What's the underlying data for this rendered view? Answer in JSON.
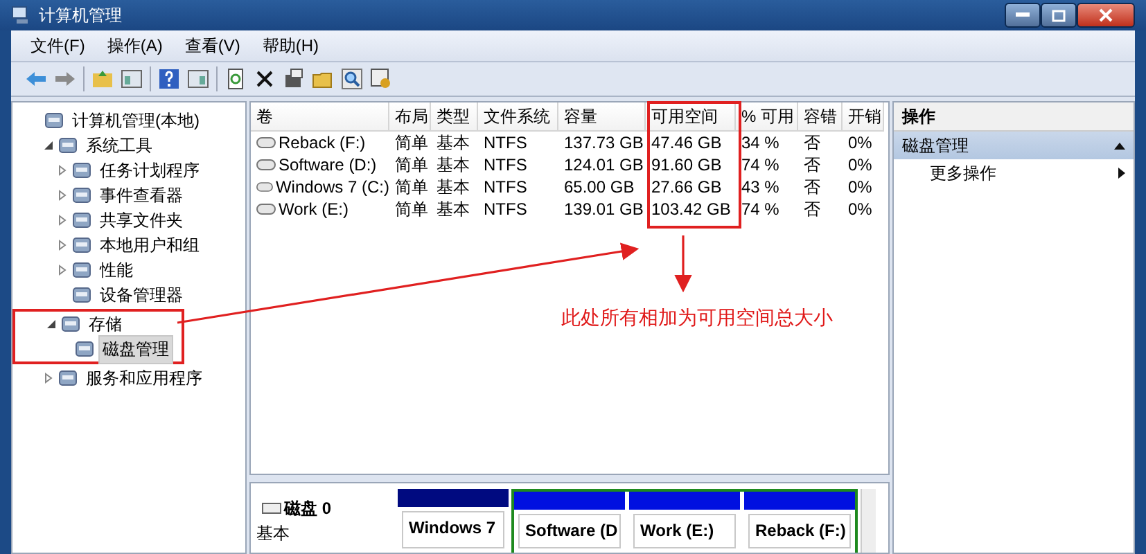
{
  "window": {
    "title": "计算机管理"
  },
  "menu": [
    {
      "label": "文件(F)"
    },
    {
      "label": "操作(A)"
    },
    {
      "label": "查看(V)"
    },
    {
      "label": "帮助(H)"
    }
  ],
  "tree": [
    {
      "label": "计算机管理(本地)",
      "selected": false,
      "children": [
        {
          "label": "系统工具",
          "expanded": true,
          "selected": false,
          "children": [
            {
              "label": "任务计划程序",
              "expanded": false,
              "selected": false
            },
            {
              "label": "事件查看器",
              "expanded": false,
              "selected": false
            },
            {
              "label": "共享文件夹",
              "expanded": false,
              "selected": false
            },
            {
              "label": "本地用户和组",
              "expanded": false,
              "selected": false
            },
            {
              "label": "性能",
              "expanded": false,
              "selected": false
            },
            {
              "label": "设备管理器",
              "selected": false
            }
          ]
        },
        {
          "label": "存储",
          "expanded": true,
          "selected": false,
          "highlighted": true,
          "children": [
            {
              "label": "磁盘管理",
              "selected": true
            }
          ]
        },
        {
          "label": "服务和应用程序",
          "expanded": false,
          "selected": false
        }
      ]
    }
  ],
  "volumes": {
    "columns": [
      "卷",
      "布局",
      "类型",
      "文件系统",
      "容量",
      "可用空间",
      "% 可用",
      "容错",
      "开销"
    ],
    "rows": [
      [
        "Reback (F:)",
        "简单",
        "基本",
        "NTFS",
        "137.73 GB",
        "47.46 GB",
        "34 %",
        "否",
        "0%"
      ],
      [
        "Software (D:)",
        "简单",
        "基本",
        "NTFS",
        "124.01 GB",
        "91.60 GB",
        "74 %",
        "否",
        "0%"
      ],
      [
        "Windows 7 (C:)",
        "简单",
        "基本",
        "NTFS",
        "65.00 GB",
        "27.66 GB",
        "43 %",
        "否",
        "0%"
      ],
      [
        "Work (E:)",
        "简单",
        "基本",
        "NTFS",
        "139.01 GB",
        "103.42 GB",
        "74 %",
        "否",
        "0%"
      ]
    ]
  },
  "disk": {
    "name": "磁盘 0",
    "type": "基本",
    "partitions": [
      {
        "label": "Windows 7",
        "kind": "primary"
      },
      {
        "label": "Software  (D",
        "kind": "logical"
      },
      {
        "label": "Work  (E:)",
        "kind": "logical"
      },
      {
        "label": "Reback  (F:)",
        "kind": "logical"
      }
    ]
  },
  "actions": {
    "title": "操作",
    "sections": [
      {
        "label": "磁盘管理",
        "expanded": true,
        "items": [
          {
            "label": "更多操作"
          }
        ]
      }
    ]
  },
  "annotation": {
    "note": "此处所有相加为可用空间总大小"
  }
}
